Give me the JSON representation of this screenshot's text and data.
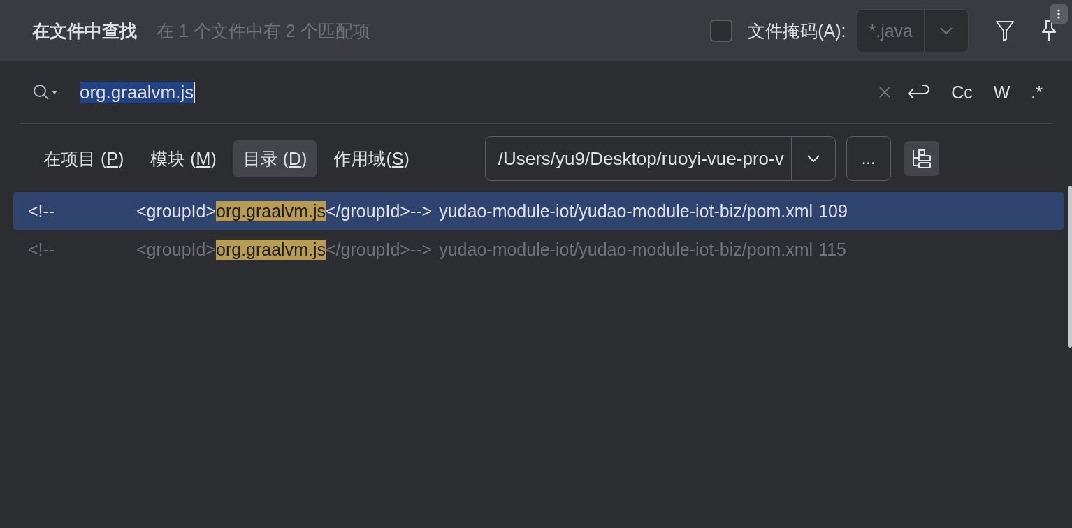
{
  "header": {
    "title": "在文件中查找",
    "summary": "在 1 个文件中有 2 个匹配项",
    "file_mask": {
      "checked": false,
      "label": "文件掩码(A):",
      "value": "*.java"
    }
  },
  "search": {
    "query": "org.graalvm.js",
    "toggles": [
      "Cc",
      "W",
      ".*"
    ]
  },
  "scopes": [
    {
      "before": "在项目 (",
      "mnemonic": "P",
      "after": ")",
      "selected": false
    },
    {
      "before": "模块 (",
      "mnemonic": "M",
      "after": ")",
      "selected": false
    },
    {
      "before": "目录 (",
      "mnemonic": "D",
      "after": ")",
      "selected": true
    },
    {
      "before": "作用域(",
      "mnemonic": "S",
      "after": ")",
      "selected": false
    }
  ],
  "directory": {
    "value": "/Users/yu9/Desktop/ruoyi-vue-pro-v",
    "browse": "..."
  },
  "results": [
    {
      "prefix": "<!--",
      "before": "<groupId>",
      "match": "org.graalvm.js",
      "after": "</groupId>-->",
      "path": "yudao-module-iot/yudao-module-iot-biz/pom.xml",
      "line": "109",
      "selected": true
    },
    {
      "prefix": "<!--",
      "before": "<groupId>",
      "match": "org.graalvm.js",
      "after": "</groupId>-->",
      "path": "yudao-module-iot/yudao-module-iot-biz/pom.xml",
      "line": "115",
      "selected": false
    }
  ]
}
